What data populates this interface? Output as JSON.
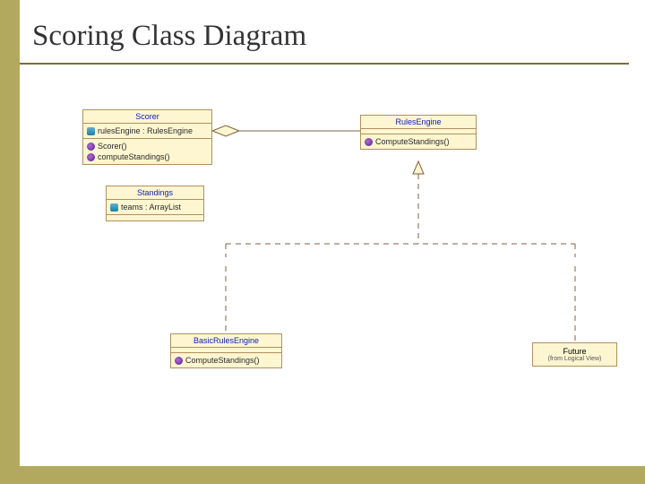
{
  "title": "Scoring Class Diagram",
  "classes": {
    "scorer": {
      "name": "Scorer",
      "attributes": [
        {
          "vis": "priv",
          "text": "rulesEngine : RulesEngine"
        }
      ],
      "operations": [
        {
          "vis": "pub",
          "text": "Scorer()"
        },
        {
          "vis": "pub",
          "text": "computeStandings()"
        }
      ]
    },
    "rulesEngine": {
      "name": "RulesEngine",
      "attributes": [],
      "operations": [
        {
          "vis": "pub",
          "text": "ComputeStandings()"
        }
      ]
    },
    "standings": {
      "name": "Standings",
      "attributes": [
        {
          "vis": "priv",
          "text": "teams : ArrayList"
        }
      ],
      "operations": []
    },
    "basicRulesEngine": {
      "name": "BasicRulesEngine",
      "attributes": [],
      "operations": [
        {
          "vis": "pub",
          "text": "ComputeStandings()"
        }
      ]
    },
    "future": {
      "name": "Future",
      "subtitle": "(from Logical View)"
    }
  },
  "relations": {
    "aggregation": "Scorer ◇— RulesEngine",
    "realization1": "BasicRulesEngine ▷┄ RulesEngine",
    "realization2": "Future ▷┄ RulesEngine"
  }
}
